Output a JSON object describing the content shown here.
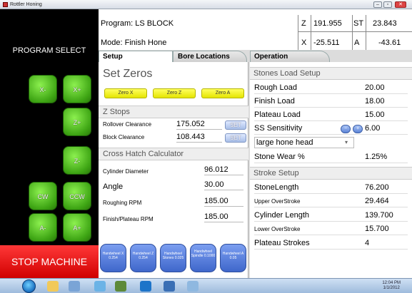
{
  "window": {
    "title": "Rottler Honing",
    "min_label": "–",
    "max_label": "▫",
    "close_label": "✕"
  },
  "header": {
    "program_text": "Program: LS BLOCK",
    "mode_text": "Mode: Finish Hone",
    "program_select_label": "PROGRAM SELECT",
    "axes": [
      {
        "label": "Z",
        "value": "191.955"
      },
      {
        "label": "ST",
        "value": "23.843"
      },
      {
        "label": "X",
        "value": "-25.511"
      },
      {
        "label": "A",
        "value": "-43.61"
      }
    ]
  },
  "tabs": [
    {
      "label": "Setup",
      "active": true
    },
    {
      "label": "Bore Locations",
      "active": false
    },
    {
      "label": "Operation",
      "active": false
    }
  ],
  "jog_buttons": {
    "x_minus": "X-",
    "x_plus": "X+",
    "z_plus": "Z+",
    "z_minus": "Z-",
    "cw": "CW",
    "ccw": "CCW",
    "a_minus": "A-",
    "a_plus": "A+"
  },
  "stop_label": "STOP MACHINE",
  "set_zeros": {
    "title": "Set Zeros",
    "buttons": [
      "Zero X",
      "Zero Z",
      "Zero A"
    ]
  },
  "z_stops": {
    "title": "Z Stops",
    "rows": [
      {
        "label": "Rollover Clearance",
        "value": "175.052",
        "button": "SET"
      },
      {
        "label": "Block Clearance",
        "value": "108.443",
        "button": "SET"
      }
    ]
  },
  "cross_hatch": {
    "title": "Cross Hatch Calculator",
    "rows": [
      {
        "label": "Cylinder Diameter",
        "value": "96.012"
      },
      {
        "label": "Angle",
        "value": "30.00"
      },
      {
        "label": "Roughing RPM",
        "value": "185.00"
      },
      {
        "label": "Finish/Plateau RPM",
        "value": "185.00"
      }
    ]
  },
  "handwheels": [
    {
      "label": "Handwheel X 0.254"
    },
    {
      "label": "Handwheel Z 0.254"
    },
    {
      "label": "Handwheel Stones 0.025"
    },
    {
      "label": "Handwheel Spindle 0.1000"
    },
    {
      "label": "Handwheel A 0.05"
    }
  ],
  "stones_load": {
    "title": "Stones Load Setup",
    "rows": [
      {
        "label": "Rough Load",
        "value": "20.00"
      },
      {
        "label": "Finish Load",
        "value": "18.00"
      },
      {
        "label": "Plateau Load",
        "value": "15.00"
      },
      {
        "label": "SS Sensitivity",
        "value": "6.00"
      }
    ],
    "hone_head": "large hone head",
    "stone_wear_label": "Stone Wear %",
    "stone_wear_value": "1.25%"
  },
  "stroke_setup": {
    "title": "Stroke Setup",
    "rows": [
      {
        "label": "StoneLength",
        "value": "76.200",
        "small": false
      },
      {
        "label": "Upper OverStroke",
        "value": "29.464",
        "small": true
      },
      {
        "label": "Cylinder Length",
        "value": "139.700",
        "small": false
      },
      {
        "label": "Lower OverStroke",
        "value": "15.700",
        "small": true
      },
      {
        "label": "Plateau Strokes",
        "value": "4",
        "small": false
      }
    ]
  },
  "taskbar": {
    "time": "12:04 PM",
    "date": "1/1/2012"
  },
  "colors": {
    "jog_green": "#3ea514",
    "stop_red": "#e00000",
    "zero_yellow": "#f2f200",
    "handwheel_blue": "#4f75d8"
  }
}
